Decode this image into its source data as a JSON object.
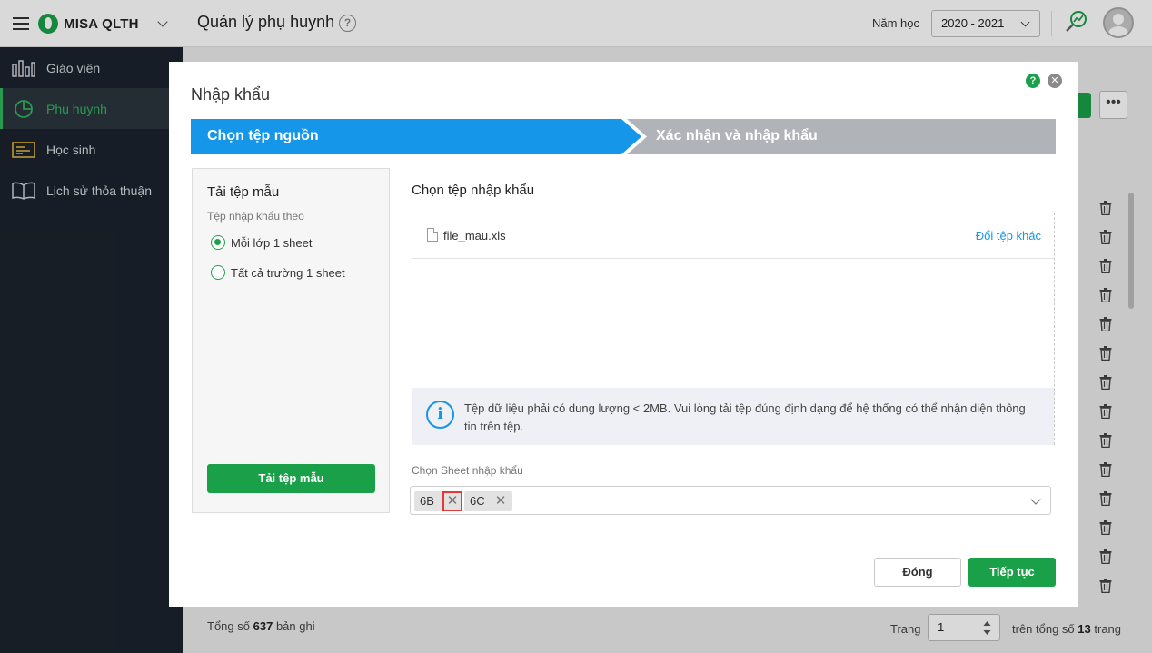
{
  "app": {
    "name": "MISA QLTH",
    "page_title": "Quản lý phụ huynh"
  },
  "header": {
    "year_label": "Năm học",
    "year_value": "2020 - 2021"
  },
  "sidebar": {
    "items": [
      {
        "label": "Giáo viên",
        "icon": "bar-chart-icon"
      },
      {
        "label": "Phụ huynh",
        "icon": "pie-chart-icon",
        "active": true
      },
      {
        "label": "Học sinh",
        "icon": "id-card-icon"
      },
      {
        "label": "Lịch sử thỏa thuận",
        "icon": "book-icon"
      }
    ]
  },
  "footer": {
    "total_prefix": "Tổng số",
    "total_count": "637",
    "total_suffix": "bản ghi",
    "page_label": "Trang",
    "page_value": "1",
    "of_prefix": "trên tổng số",
    "page_total": "13",
    "of_suffix": "trang"
  },
  "modal": {
    "title": "Nhập khẩu",
    "steps": [
      "Chọn tệp nguồn",
      "Xác nhận và nhập khẩu"
    ],
    "left": {
      "title": "Tải tệp mẫu",
      "subtitle": "Tệp nhập khẩu theo",
      "options": [
        "Mỗi lớp 1 sheet",
        "Tất cả trường 1 sheet"
      ],
      "selected": 0,
      "button": "Tải tệp mẫu"
    },
    "right": {
      "title": "Chọn tệp nhập khẩu",
      "file_name": "file_mau.xls",
      "change_file": "Đổi tệp khác",
      "info": "Tệp dữ liệu phải có dung lượng < 2MB. Vui lòng tải tệp đúng định dạng để hệ thống có thể nhận diện thông tin trên tệp.",
      "sheet_label": "Chọn Sheet nhập khẩu",
      "sheets": [
        "6B",
        "6C"
      ]
    },
    "buttons": {
      "close": "Đóng",
      "next": "Tiếp tục"
    }
  },
  "colors": {
    "primary_green": "#1aa049",
    "step_blue": "#1596e8",
    "step_grey": "#b0b4b9",
    "sidebar_bg": "#1b232d",
    "highlight_red": "#e53935"
  }
}
